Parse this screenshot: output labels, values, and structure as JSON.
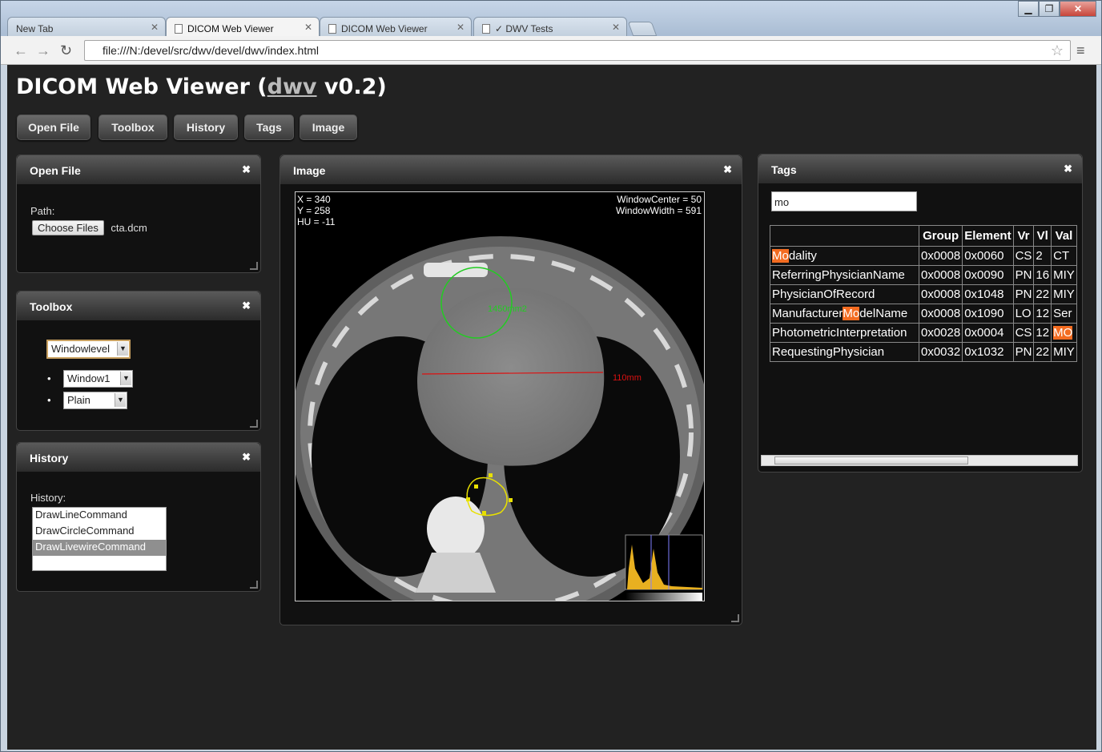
{
  "browser": {
    "tabs": [
      {
        "label": "New Tab"
      },
      {
        "label": "DICOM Web Viewer"
      },
      {
        "label": "DICOM Web Viewer"
      },
      {
        "label": "✓ DWV Tests"
      }
    ],
    "url": "file:///N:/devel/src/dwv/devel/dwv/index.html"
  },
  "app": {
    "title_prefix": "DICOM Web Viewer (",
    "title_link": "dwv",
    "title_suffix": " v0.2)",
    "buttons": {
      "open_file": "Open File",
      "toolbox": "Toolbox",
      "history": "History",
      "tags": "Tags",
      "image": "Image"
    }
  },
  "open_file_panel": {
    "title": "Open File",
    "path_label": "Path:",
    "choose_label": "Choose Files",
    "file_name": "cta.dcm"
  },
  "toolbox_panel": {
    "title": "Toolbox",
    "tool": "Windowlevel",
    "preset": "Window1",
    "colormap": "Plain"
  },
  "history_panel": {
    "title": "History",
    "label": "History:",
    "items": [
      "DrawLineCommand",
      "DrawCircleCommand",
      "DrawLivewireCommand"
    ]
  },
  "image_panel": {
    "title": "Image",
    "x": "X = 340",
    "y": "Y = 258",
    "hu": "HU = -11",
    "window_center": "WindowCenter = 50",
    "window_width": "WindowWidth = 591",
    "circle_annotation": "1450mm2",
    "line_annotation": "110mm"
  },
  "tags_panel": {
    "title": "Tags",
    "search_value": "mo",
    "headers": [
      "",
      "Group",
      "Element",
      "Vr",
      "Vl",
      "Val"
    ],
    "rows": [
      {
        "hl_pre": "",
        "hl": "Mo",
        "name_post": "dality",
        "group": "0x0008",
        "element": "0x0060",
        "vr": "CS",
        "vl": "2",
        "val_hl": "",
        "val": "CT"
      },
      {
        "hl_pre": "ReferringPhysicianName",
        "hl": "",
        "name_post": "",
        "group": "0x0008",
        "element": "0x0090",
        "vr": "PN",
        "vl": "16",
        "val_hl": "",
        "val": "MIY"
      },
      {
        "hl_pre": "PhysicianOfRecord",
        "hl": "",
        "name_post": "",
        "group": "0x0008",
        "element": "0x1048",
        "vr": "PN",
        "vl": "22",
        "val_hl": "",
        "val": "MIY"
      },
      {
        "hl_pre": "Manufacturer",
        "hl": "Mo",
        "name_post": "delName",
        "group": "0x0008",
        "element": "0x1090",
        "vr": "LO",
        "vl": "12",
        "val_hl": "",
        "val": "Ser"
      },
      {
        "hl_pre": "PhotometricInterpretation",
        "hl": "",
        "name_post": "",
        "group": "0x0028",
        "element": "0x0004",
        "vr": "CS",
        "vl": "12",
        "val_hl": "MO",
        "val": ""
      },
      {
        "hl_pre": "RequestingPhysician",
        "hl": "",
        "name_post": "",
        "group": "0x0032",
        "element": "0x1032",
        "vr": "PN",
        "vl": "22",
        "val_hl": "",
        "val": "MIY"
      }
    ]
  },
  "colors": {
    "page_bg": "#222222",
    "highlight": "#f36c21",
    "circle": "#22cc22",
    "line": "#dd1111",
    "livewire": "#e8e000",
    "histogram": "#e8b020"
  }
}
